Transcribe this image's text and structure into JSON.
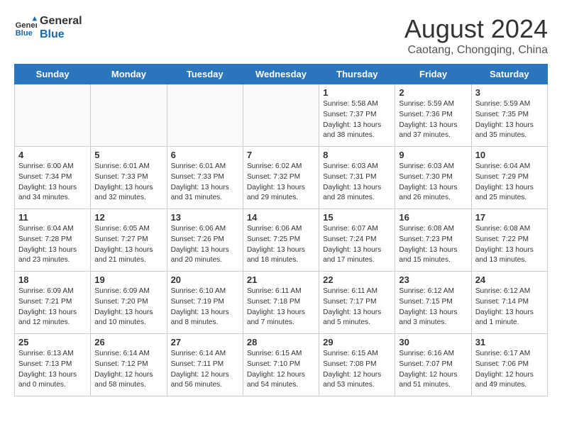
{
  "header": {
    "logo_line1": "General",
    "logo_line2": "Blue",
    "main_title": "August 2024",
    "subtitle": "Caotang, Chongqing, China"
  },
  "days_of_week": [
    "Sunday",
    "Monday",
    "Tuesday",
    "Wednesday",
    "Thursday",
    "Friday",
    "Saturday"
  ],
  "weeks": [
    [
      {
        "day": "",
        "content": ""
      },
      {
        "day": "",
        "content": ""
      },
      {
        "day": "",
        "content": ""
      },
      {
        "day": "",
        "content": ""
      },
      {
        "day": "1",
        "content": "Sunrise: 5:58 AM\nSunset: 7:37 PM\nDaylight: 13 hours\nand 38 minutes."
      },
      {
        "day": "2",
        "content": "Sunrise: 5:59 AM\nSunset: 7:36 PM\nDaylight: 13 hours\nand 37 minutes."
      },
      {
        "day": "3",
        "content": "Sunrise: 5:59 AM\nSunset: 7:35 PM\nDaylight: 13 hours\nand 35 minutes."
      }
    ],
    [
      {
        "day": "4",
        "content": "Sunrise: 6:00 AM\nSunset: 7:34 PM\nDaylight: 13 hours\nand 34 minutes."
      },
      {
        "day": "5",
        "content": "Sunrise: 6:01 AM\nSunset: 7:33 PM\nDaylight: 13 hours\nand 32 minutes."
      },
      {
        "day": "6",
        "content": "Sunrise: 6:01 AM\nSunset: 7:33 PM\nDaylight: 13 hours\nand 31 minutes."
      },
      {
        "day": "7",
        "content": "Sunrise: 6:02 AM\nSunset: 7:32 PM\nDaylight: 13 hours\nand 29 minutes."
      },
      {
        "day": "8",
        "content": "Sunrise: 6:03 AM\nSunset: 7:31 PM\nDaylight: 13 hours\nand 28 minutes."
      },
      {
        "day": "9",
        "content": "Sunrise: 6:03 AM\nSunset: 7:30 PM\nDaylight: 13 hours\nand 26 minutes."
      },
      {
        "day": "10",
        "content": "Sunrise: 6:04 AM\nSunset: 7:29 PM\nDaylight: 13 hours\nand 25 minutes."
      }
    ],
    [
      {
        "day": "11",
        "content": "Sunrise: 6:04 AM\nSunset: 7:28 PM\nDaylight: 13 hours\nand 23 minutes."
      },
      {
        "day": "12",
        "content": "Sunrise: 6:05 AM\nSunset: 7:27 PM\nDaylight: 13 hours\nand 21 minutes."
      },
      {
        "day": "13",
        "content": "Sunrise: 6:06 AM\nSunset: 7:26 PM\nDaylight: 13 hours\nand 20 minutes."
      },
      {
        "day": "14",
        "content": "Sunrise: 6:06 AM\nSunset: 7:25 PM\nDaylight: 13 hours\nand 18 minutes."
      },
      {
        "day": "15",
        "content": "Sunrise: 6:07 AM\nSunset: 7:24 PM\nDaylight: 13 hours\nand 17 minutes."
      },
      {
        "day": "16",
        "content": "Sunrise: 6:08 AM\nSunset: 7:23 PM\nDaylight: 13 hours\nand 15 minutes."
      },
      {
        "day": "17",
        "content": "Sunrise: 6:08 AM\nSunset: 7:22 PM\nDaylight: 13 hours\nand 13 minutes."
      }
    ],
    [
      {
        "day": "18",
        "content": "Sunrise: 6:09 AM\nSunset: 7:21 PM\nDaylight: 13 hours\nand 12 minutes."
      },
      {
        "day": "19",
        "content": "Sunrise: 6:09 AM\nSunset: 7:20 PM\nDaylight: 13 hours\nand 10 minutes."
      },
      {
        "day": "20",
        "content": "Sunrise: 6:10 AM\nSunset: 7:19 PM\nDaylight: 13 hours\nand 8 minutes."
      },
      {
        "day": "21",
        "content": "Sunrise: 6:11 AM\nSunset: 7:18 PM\nDaylight: 13 hours\nand 7 minutes."
      },
      {
        "day": "22",
        "content": "Sunrise: 6:11 AM\nSunset: 7:17 PM\nDaylight: 13 hours\nand 5 minutes."
      },
      {
        "day": "23",
        "content": "Sunrise: 6:12 AM\nSunset: 7:15 PM\nDaylight: 13 hours\nand 3 minutes."
      },
      {
        "day": "24",
        "content": "Sunrise: 6:12 AM\nSunset: 7:14 PM\nDaylight: 13 hours\nand 1 minute."
      }
    ],
    [
      {
        "day": "25",
        "content": "Sunrise: 6:13 AM\nSunset: 7:13 PM\nDaylight: 13 hours\nand 0 minutes."
      },
      {
        "day": "26",
        "content": "Sunrise: 6:14 AM\nSunset: 7:12 PM\nDaylight: 12 hours\nand 58 minutes."
      },
      {
        "day": "27",
        "content": "Sunrise: 6:14 AM\nSunset: 7:11 PM\nDaylight: 12 hours\nand 56 minutes."
      },
      {
        "day": "28",
        "content": "Sunrise: 6:15 AM\nSunset: 7:10 PM\nDaylight: 12 hours\nand 54 minutes."
      },
      {
        "day": "29",
        "content": "Sunrise: 6:15 AM\nSunset: 7:08 PM\nDaylight: 12 hours\nand 53 minutes."
      },
      {
        "day": "30",
        "content": "Sunrise: 6:16 AM\nSunset: 7:07 PM\nDaylight: 12 hours\nand 51 minutes."
      },
      {
        "day": "31",
        "content": "Sunrise: 6:17 AM\nSunset: 7:06 PM\nDaylight: 12 hours\nand 49 minutes."
      }
    ]
  ]
}
